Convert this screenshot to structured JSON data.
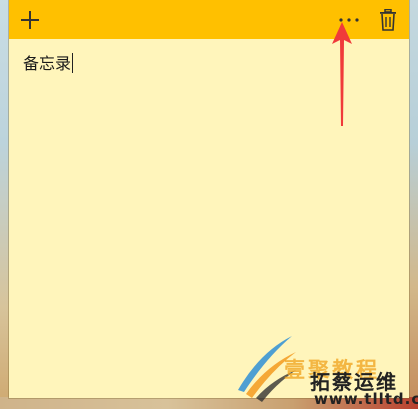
{
  "title_bar": {
    "color": "#ffc000",
    "buttons": [
      {
        "icon": "plus-icon",
        "label": "新建笔记"
      },
      {
        "icon": "more-dots-icon",
        "label": "菜单"
      },
      {
        "icon": "trash-icon",
        "label": "删除笔记"
      }
    ]
  },
  "note": {
    "background": "#fff5bb",
    "content": "备忘录"
  },
  "annotation": {
    "arrow_color": "#f03a3a",
    "points_to": "more-dots-icon"
  },
  "watermark": {
    "line1": "壹聚教程",
    "line2": "拓蔡运维",
    "url": "www.tlltd.cn"
  }
}
